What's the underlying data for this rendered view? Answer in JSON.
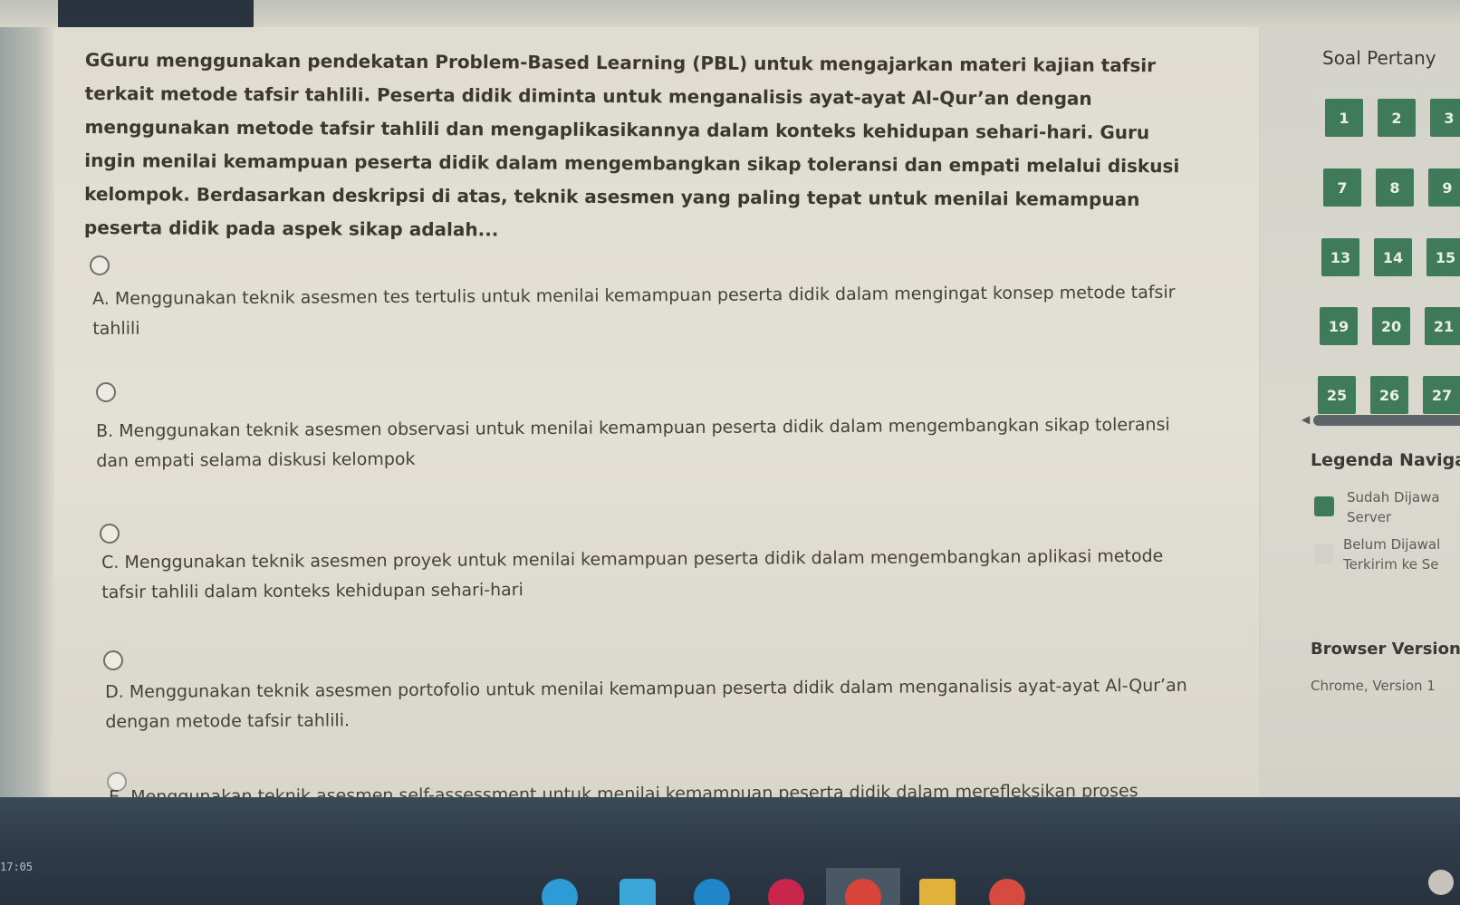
{
  "question": {
    "text": "GGuru menggunakan pendekatan Problem-Based Learning (PBL) untuk mengajarkan materi kajian tafsir terkait metode tafsir tahlili. Peserta didik diminta untuk menganalisis ayat-ayat Al-Qur’an dengan menggunakan metode tafsir tahlili dan mengaplikasikannya dalam konteks kehidupan sehari-hari. Guru ingin menilai kemampuan peserta didik dalam mengembangkan sikap toleransi dan empati melalui diskusi kelompok. Berdasarkan deskripsi di atas, teknik asesmen yang paling tepat untuk menilai kemampuan peserta didik pada aspek sikap adalah..."
  },
  "options": [
    {
      "label": "A. Menggunakan teknik asesmen tes tertulis untuk menilai kemampuan peserta didik dalam mengingat konsep metode tafsir tahlili"
    },
    {
      "label": "B. Menggunakan teknik asesmen observasi untuk menilai kemampuan peserta didik dalam mengembangkan sikap toleransi dan empati selama diskusi kelompok"
    },
    {
      "label": "C. Menggunakan teknik asesmen proyek untuk menilai kemampuan peserta didik dalam mengembangkan aplikasi metode tafsir tahlili dalam konteks kehidupan sehari-hari"
    },
    {
      "label": "D. Menggunakan teknik asesmen portofolio untuk menilai kemampuan peserta didik dalam menganalisis ayat-ayat Al-Qur’an dengan metode tafsir tahlili."
    },
    {
      "label": "E. Menggunakan teknik asesmen self-assessment untuk menilai kemampuan peserta didik dalam merefleksikan proses"
    }
  ],
  "nav": {
    "title": "Soal Pertany",
    "numbers": [
      "1",
      "2",
      "3",
      "7",
      "8",
      "9",
      "13",
      "14",
      "15",
      "19",
      "20",
      "21",
      "25",
      "26",
      "27"
    ],
    "answered_color": "#3f7b5b"
  },
  "legend": {
    "title": "Legenda Naviga",
    "answered_line1": "Sudah Dijawa",
    "answered_line2": "Server",
    "unanswered_line1": "Belum Dijawal",
    "unanswered_line2": "Terkirim ke Se",
    "answered_color": "#3f7b5b",
    "unanswered_color": "#d2d1c9"
  },
  "browser": {
    "title": "Browser Version",
    "text": "Chrome, Version 1"
  },
  "taskbar": {
    "time": "17:05"
  }
}
